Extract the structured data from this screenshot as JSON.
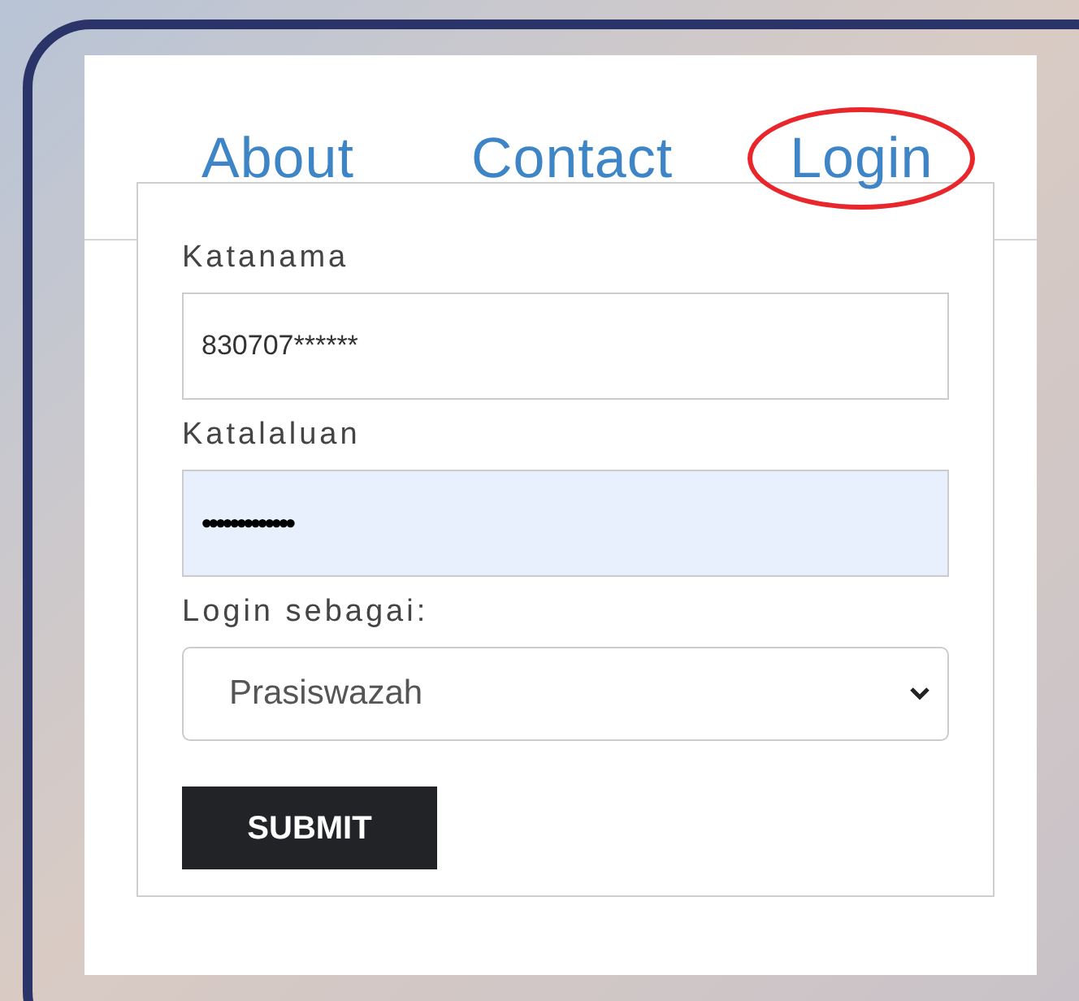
{
  "nav": [
    {
      "label": "About",
      "highlighted": false
    },
    {
      "label": "Contact",
      "highlighted": false
    },
    {
      "label": "Login",
      "highlighted": true
    }
  ],
  "login_form": {
    "fields": [
      {
        "kind": "text",
        "label": "Katanama",
        "value": "830707******"
      },
      {
        "kind": "password",
        "label": "Katalaluan",
        "value": "•••••••••••••"
      },
      {
        "kind": "select",
        "label": "Login sebagai:",
        "value": "Prasiswazah"
      }
    ],
    "submit": "SUBMIT"
  }
}
